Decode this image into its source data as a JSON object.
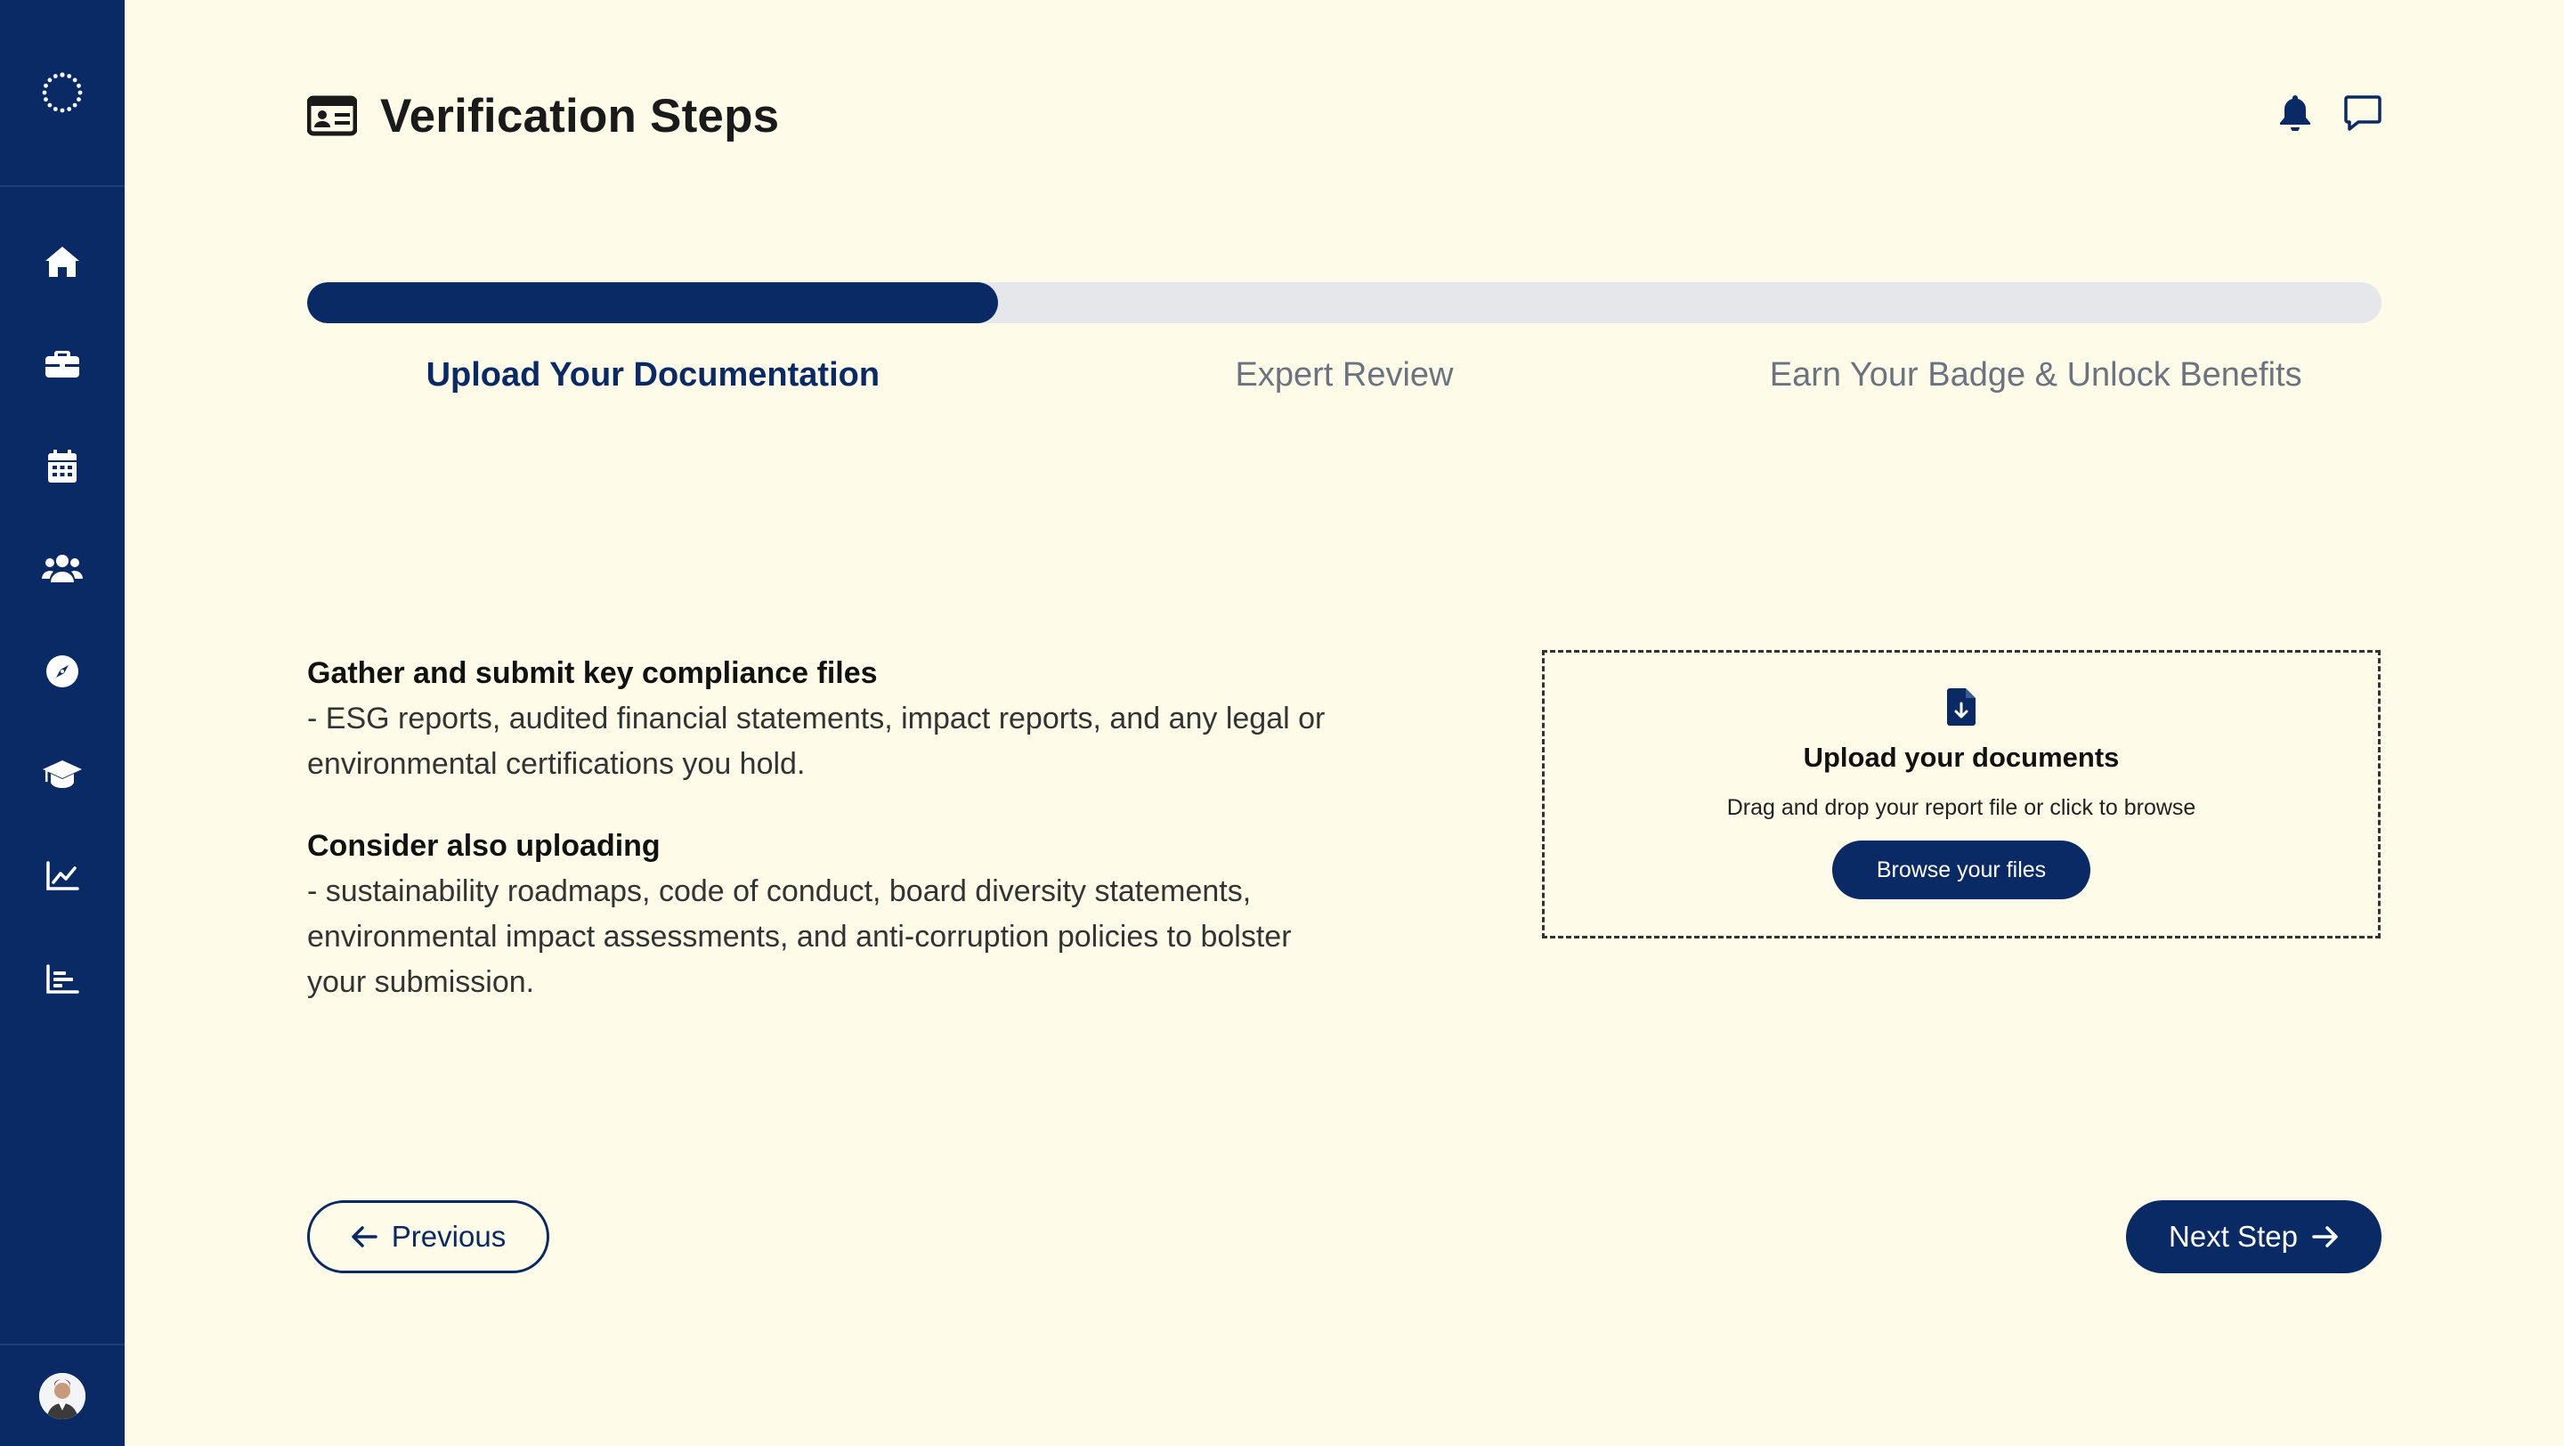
{
  "app": {
    "accent_color": "#0a2a66",
    "background_color": "#fefce8"
  },
  "sidebar": {
    "logo_icon": "spinner-dots-logo",
    "items": [
      {
        "icon": "home-icon"
      },
      {
        "icon": "briefcase-icon"
      },
      {
        "icon": "calendar-icon"
      },
      {
        "icon": "users-icon"
      },
      {
        "icon": "compass-icon"
      },
      {
        "icon": "graduation-cap-icon"
      },
      {
        "icon": "line-chart-icon"
      },
      {
        "icon": "bar-chart-icon"
      }
    ],
    "footer_icon": "user-avatar"
  },
  "header": {
    "icon": "id-card-icon",
    "title": "Verification Steps",
    "right_icons": [
      "bell-icon",
      "chat-icon"
    ]
  },
  "progress": {
    "fraction": 0.333,
    "steps": [
      {
        "label": "Upload Your Documentation",
        "active": true
      },
      {
        "label": "Expert Review",
        "active": false
      },
      {
        "label": "Earn Your Badge & Unlock Benefits",
        "active": false
      }
    ]
  },
  "info": {
    "section1_heading": "Gather and submit key compliance files",
    "section1_body": "- ESG reports, audited financial statements, impact reports, and any legal or environmental certifications you hold.",
    "section2_heading": "Consider also uploading",
    "section2_body": "- sustainability roadmaps, code of conduct, board diversity statements, environmental impact assessments, and anti-corruption policies to bolster your submission."
  },
  "upload": {
    "icon": "file-download-icon",
    "title": "Upload your documents",
    "subtitle": "Drag and drop your report file or click to browse",
    "button_label": "Browse your files"
  },
  "nav": {
    "previous_label": "Previous",
    "next_label": "Next Step"
  }
}
